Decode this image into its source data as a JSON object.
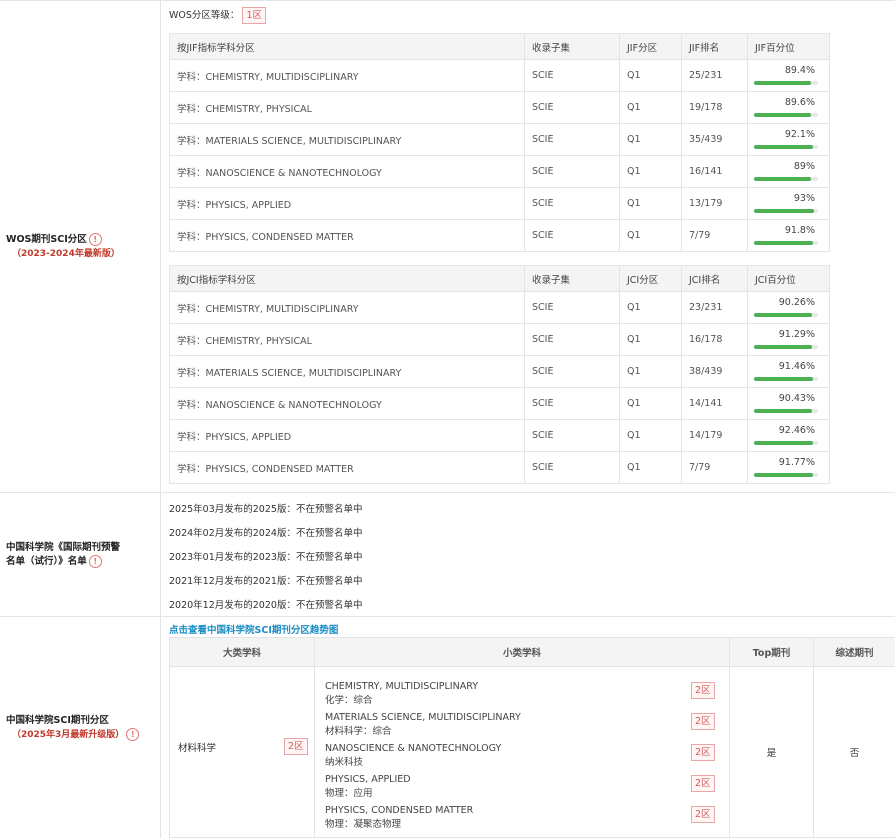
{
  "wos": {
    "label": "WOS期刊SCI分区",
    "sub": "（2023-2024年最新版）",
    "level_label": "WOS分区等级：",
    "level_value": "1区",
    "jif": {
      "headers": [
        "按JIF指标学科分区",
        "收录子集",
        "JIF分区",
        "JIF排名",
        "JIF百分位"
      ],
      "rows": [
        {
          "subject": "学科：CHEMISTRY, MULTIDISCIPLINARY",
          "set": "SCIE",
          "q": "Q1",
          "rank": "25/231",
          "pct": "89.4%",
          "p": 89.4
        },
        {
          "subject": "学科：CHEMISTRY, PHYSICAL",
          "set": "SCIE",
          "q": "Q1",
          "rank": "19/178",
          "pct": "89.6%",
          "p": 89.6
        },
        {
          "subject": "学科：MATERIALS SCIENCE, MULTIDISCIPLINARY",
          "set": "SCIE",
          "q": "Q1",
          "rank": "35/439",
          "pct": "92.1%",
          "p": 92.1
        },
        {
          "subject": "学科：NANOSCIENCE & NANOTECHNOLOGY",
          "set": "SCIE",
          "q": "Q1",
          "rank": "16/141",
          "pct": "89%",
          "p": 89
        },
        {
          "subject": "学科：PHYSICS, APPLIED",
          "set": "SCIE",
          "q": "Q1",
          "rank": "13/179",
          "pct": "93%",
          "p": 93
        },
        {
          "subject": "学科：PHYSICS, CONDENSED MATTER",
          "set": "SCIE",
          "q": "Q1",
          "rank": "7/79",
          "pct": "91.8%",
          "p": 91.8
        }
      ]
    },
    "jci": {
      "headers": [
        "按JCI指标学科分区",
        "收录子集",
        "JCI分区",
        "JCI排名",
        "JCI百分位"
      ],
      "rows": [
        {
          "subject": "学科：CHEMISTRY, MULTIDISCIPLINARY",
          "set": "SCIE",
          "q": "Q1",
          "rank": "23/231",
          "pct": "90.26%",
          "p": 90.26
        },
        {
          "subject": "学科：CHEMISTRY, PHYSICAL",
          "set": "SCIE",
          "q": "Q1",
          "rank": "16/178",
          "pct": "91.29%",
          "p": 91.29
        },
        {
          "subject": "学科：MATERIALS SCIENCE, MULTIDISCIPLINARY",
          "set": "SCIE",
          "q": "Q1",
          "rank": "38/439",
          "pct": "91.46%",
          "p": 91.46
        },
        {
          "subject": "学科：NANOSCIENCE & NANOTECHNOLOGY",
          "set": "SCIE",
          "q": "Q1",
          "rank": "14/141",
          "pct": "90.43%",
          "p": 90.43
        },
        {
          "subject": "学科：PHYSICS, APPLIED",
          "set": "SCIE",
          "q": "Q1",
          "rank": "14/179",
          "pct": "92.46%",
          "p": 92.46
        },
        {
          "subject": "学科：PHYSICS, CONDENSED MATTER",
          "set": "SCIE",
          "q": "Q1",
          "rank": "7/79",
          "pct": "91.77%",
          "p": 91.77
        }
      ]
    }
  },
  "warning": {
    "label_line1": "中国科学院《国际期刊预警",
    "label_line2": "名单（试行）》名单",
    "lines": [
      "2025年03月发布的2025版：不在预警名单中",
      "2024年02月发布的2024版：不在预警名单中",
      "2023年01月发布的2023版：不在预警名单中",
      "2021年12月发布的2021版：不在预警名单中",
      "2020年12月发布的2020版：不在预警名单中"
    ]
  },
  "cas": {
    "label": "中国科学院SCI期刊分区",
    "sub": "（2025年3月最新升级版）",
    "trend_link": "点击查看中国科学院SCI期刊分区趋势图",
    "headers": [
      "大类学科",
      "小类学科",
      "Top期刊",
      "综述期刊"
    ],
    "major": "材料科学",
    "major_zone": "2区",
    "top": "是",
    "review": "否",
    "minors": [
      {
        "en": "CHEMISTRY, MULTIDISCIPLINARY",
        "zh": "化学：综合",
        "zone": "2区"
      },
      {
        "en": "MATERIALS SCIENCE, MULTIDISCIPLINARY",
        "zh": "材料科学：综合",
        "zone": "2区"
      },
      {
        "en": "NANOSCIENCE & NANOTECHNOLOGY",
        "zh": "纳米科技",
        "zone": "2区"
      },
      {
        "en": "PHYSICS, APPLIED",
        "zh": "物理：应用",
        "zone": "2区"
      },
      {
        "en": "PHYSICS, CONDENSED MATTER",
        "zh": "物理：凝聚态物理",
        "zone": "2区"
      }
    ]
  }
}
